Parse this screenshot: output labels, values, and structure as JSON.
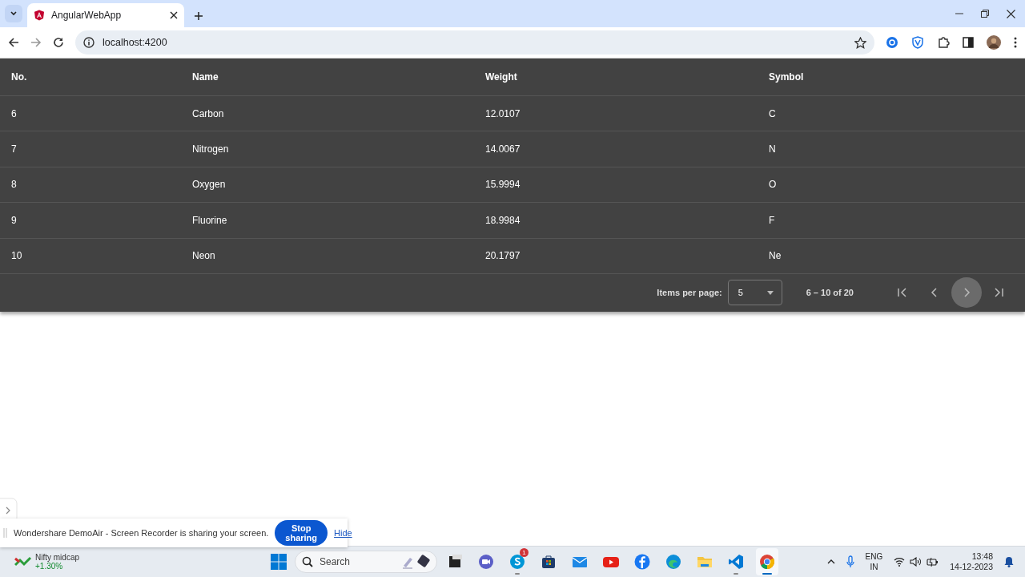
{
  "browser": {
    "tab_title": "AngularWebApp",
    "url": "localhost:4200"
  },
  "table": {
    "columns": [
      "No.",
      "Name",
      "Weight",
      "Symbol"
    ],
    "rows": [
      [
        "6",
        "Carbon",
        "12.0107",
        "C"
      ],
      [
        "7",
        "Nitrogen",
        "14.0067",
        "N"
      ],
      [
        "8",
        "Oxygen",
        "15.9994",
        "O"
      ],
      [
        "9",
        "Fluorine",
        "18.9984",
        "F"
      ],
      [
        "10",
        "Neon",
        "20.1797",
        "Ne"
      ]
    ]
  },
  "paginator": {
    "label": "Items per page:",
    "page_size": "5",
    "range": "6 – 10 of 20",
    "buttons": [
      {
        "kind": "first",
        "hovered": false
      },
      {
        "kind": "prev",
        "hovered": false
      },
      {
        "kind": "next",
        "hovered": true
      },
      {
        "kind": "last",
        "hovered": false
      }
    ]
  },
  "share_bar": {
    "message": "Wondershare DemoAir - Screen Recorder is sharing your screen.",
    "stop_button": "Stop sharing",
    "hide_link": "Hide"
  },
  "taskbar": {
    "widget_name": "Nifty midcap",
    "widget_change": "+1.30%",
    "search_placeholder": "Search",
    "apps": [
      {
        "kind": "files-dark",
        "running": false,
        "selected": false
      },
      {
        "kind": "meet",
        "running": false,
        "selected": false
      },
      {
        "kind": "skype",
        "badge": "1",
        "running": true,
        "selected": false
      },
      {
        "kind": "store",
        "running": false,
        "selected": false
      },
      {
        "kind": "mail",
        "running": false,
        "selected": false
      },
      {
        "kind": "youtube",
        "running": false,
        "selected": false
      },
      {
        "kind": "facebook",
        "running": false,
        "selected": false
      },
      {
        "kind": "edge",
        "running": false,
        "selected": false
      },
      {
        "kind": "folder",
        "running": false,
        "selected": false
      },
      {
        "kind": "vscode",
        "running": true,
        "selected": false
      },
      {
        "kind": "chrome",
        "running": true,
        "selected": true
      }
    ],
    "language": "ENG",
    "region": "IN",
    "time": "13:48",
    "date": "14-12-2023"
  }
}
